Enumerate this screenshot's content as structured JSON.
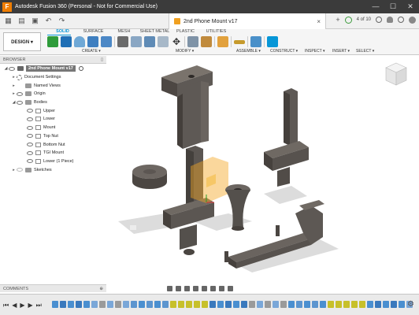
{
  "window": {
    "title": "Autodesk Fusion 360 (Personal - Not for Commercial Use)",
    "app_logo_letter": "F",
    "controls": [
      "—",
      "☐",
      "✕"
    ]
  },
  "document_tab": {
    "title": "2nd Phone Mount v17",
    "close": "×"
  },
  "quick_access": {
    "count": "4 of 10"
  },
  "toolbar": {
    "workspace_label": "DESIGN ▾",
    "tabs": [
      "SOLID",
      "SURFACE",
      "MESH",
      "SHEET METAL",
      "PLASTIC",
      "UTILITIES"
    ],
    "active_tab": "SOLID",
    "groups": [
      "CREATE ▾",
      "MODIFY ▾",
      "ASSEMBLE ▾",
      "CONSTRUCT ▾",
      "INSPECT ▾",
      "INSERT ▾",
      "SELECT ▾"
    ]
  },
  "browser": {
    "header": "BROWSER",
    "root": "2nd Phone Mount v17",
    "items": [
      {
        "label": "Document Settings",
        "type": "gear"
      },
      {
        "label": "Named Views",
        "type": "folder"
      },
      {
        "label": "Origin",
        "type": "folder"
      },
      {
        "label": "Bodies",
        "type": "folder"
      }
    ],
    "bodies": [
      "Upper",
      "Lower",
      "Mount",
      "Top Nut",
      "Bottom Nut",
      "TGI Mount",
      "Lower (1 Piece)"
    ],
    "sketches": "Sketches"
  },
  "comments": {
    "label": "COMMENTS"
  },
  "timeline": {
    "controls": [
      "⏮",
      "◀",
      "▶",
      "▶",
      "⏭"
    ],
    "settings_icon": "⚙"
  },
  "colors": {
    "accent": "#0696d7",
    "titlebar": "#3b3b3b",
    "model_gray": "#5e5955",
    "highlight_orange": "#f5a623"
  }
}
